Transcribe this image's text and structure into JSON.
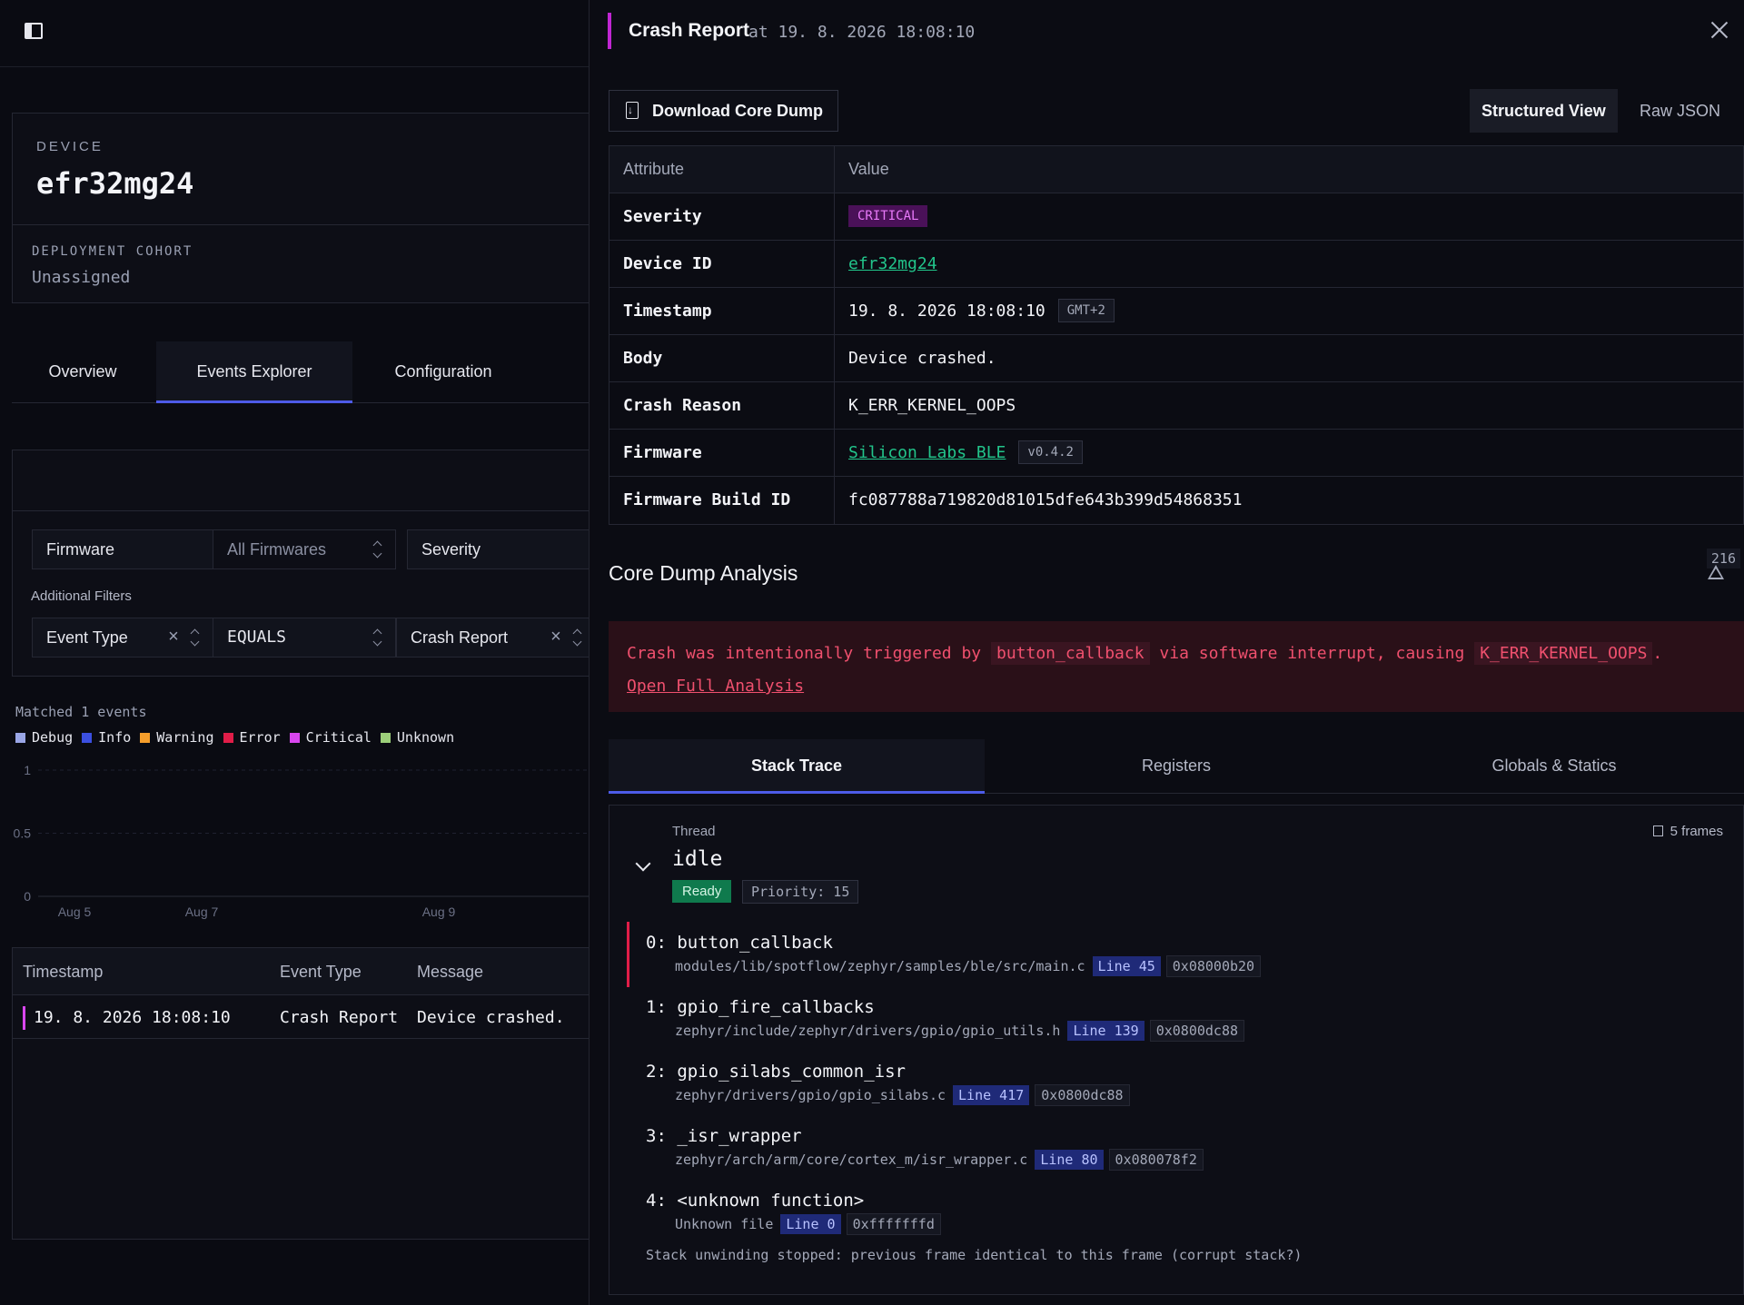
{
  "left": {
    "device_label": "DEVICE",
    "device_name": "efr32mg24",
    "cohort_label": "DEPLOYMENT COHORT",
    "cohort_value": "Unassigned",
    "tabs": [
      {
        "label": "Overview"
      },
      {
        "label": "Events Explorer",
        "active": true
      },
      {
        "label": "Configuration"
      }
    ],
    "filters": {
      "firmware_label": "Firmware",
      "firmware_value": "All Firmwares",
      "severity_label": "Severity",
      "additional_label": "Additional Filters",
      "field": "Event Type",
      "operator": "EQUALS",
      "value": "Crash Report"
    },
    "matched": "Matched 1 events",
    "legend": [
      {
        "label": "Debug",
        "color": "#9aa6e6"
      },
      {
        "label": "Info",
        "color": "#3b4fe0"
      },
      {
        "label": "Warning",
        "color": "#f59e2b"
      },
      {
        "label": "Error",
        "color": "#e11d48"
      },
      {
        "label": "Critical",
        "color": "#d946ef"
      },
      {
        "label": "Unknown",
        "color": "#9ccf7a"
      }
    ],
    "chart_data": {
      "type": "bar",
      "categories": [
        "Aug 5",
        "Aug 7",
        "Aug 9"
      ],
      "yticks": [
        "1",
        "0.5",
        "0"
      ],
      "ylim": [
        0,
        1
      ],
      "grid": true
    },
    "table": {
      "headers": [
        "Timestamp",
        "Event Type",
        "Message"
      ],
      "rows": [
        {
          "timestamp": "19. 8. 2026 18:08:10",
          "type": "Crash Report",
          "message": "Device crashed."
        }
      ]
    }
  },
  "right": {
    "title": "Crash Report",
    "at": "at 19. 8. 2026 18:08:10",
    "download_label": "Download Core Dump",
    "views": [
      "Structured View",
      "Raw JSON"
    ],
    "attr_headers": [
      "Attribute",
      "Value"
    ],
    "attrs": {
      "severity_k": "Severity",
      "severity_v": "CRITICAL",
      "device_k": "Device ID",
      "device_v": "efr32mg24",
      "ts_k": "Timestamp",
      "ts_v": "19. 8. 2026 18:08:10",
      "ts_tz": "GMT+2",
      "body_k": "Body",
      "body_v": "Device crashed.",
      "reason_k": "Crash Reason",
      "reason_v": "K_ERR_KERNEL_OOPS",
      "fw_k": "Firmware",
      "fw_v": "Silicon Labs BLE",
      "fw_ver": "v0.4.2",
      "build_k": "Firmware Build ID",
      "build_v": "fc087788a719820d81015dfe643b399d54868351"
    },
    "cda_title": "Core Dump Analysis",
    "warning_count": "216",
    "analysis": {
      "p1": "Crash was intentionally triggered by",
      "c1": "button_callback",
      "p2": "via software interrupt, causing",
      "c2": "K_ERR_KERNEL_OOPS",
      "p3": ".",
      "link": "Open Full Analysis"
    },
    "tabs": [
      "Stack Trace",
      "Registers",
      "Globals & Statics"
    ],
    "thread": {
      "label": "Thread",
      "name": "idle",
      "state": "Ready",
      "priority": "Priority: 15",
      "frames_count": "5 frames"
    },
    "frames": [
      {
        "fn": "0: button_callback",
        "file": "modules/lib/spotflow/zephyr/samples/ble/src/main.c",
        "line": "Line 45",
        "addr": "0x08000b20"
      },
      {
        "fn": "1: gpio_fire_callbacks",
        "file": "zephyr/include/zephyr/drivers/gpio/gpio_utils.h",
        "line": "Line 139",
        "addr": "0x0800dc88"
      },
      {
        "fn": "2: gpio_silabs_common_isr",
        "file": "zephyr/drivers/gpio/gpio_silabs.c",
        "line": "Line 417",
        "addr": "0x0800dc88"
      },
      {
        "fn": "3: _isr_wrapper",
        "file": "zephyr/arch/arm/core/cortex_m/isr_wrapper.c",
        "line": "Line 80",
        "addr": "0x080078f2"
      },
      {
        "fn": "4: <unknown function>",
        "file": "Unknown file",
        "line": "Line 0",
        "addr": "0xfffffffd"
      }
    ],
    "stop_note": "Stack unwinding stopped: previous frame identical to this frame (corrupt stack?)"
  }
}
